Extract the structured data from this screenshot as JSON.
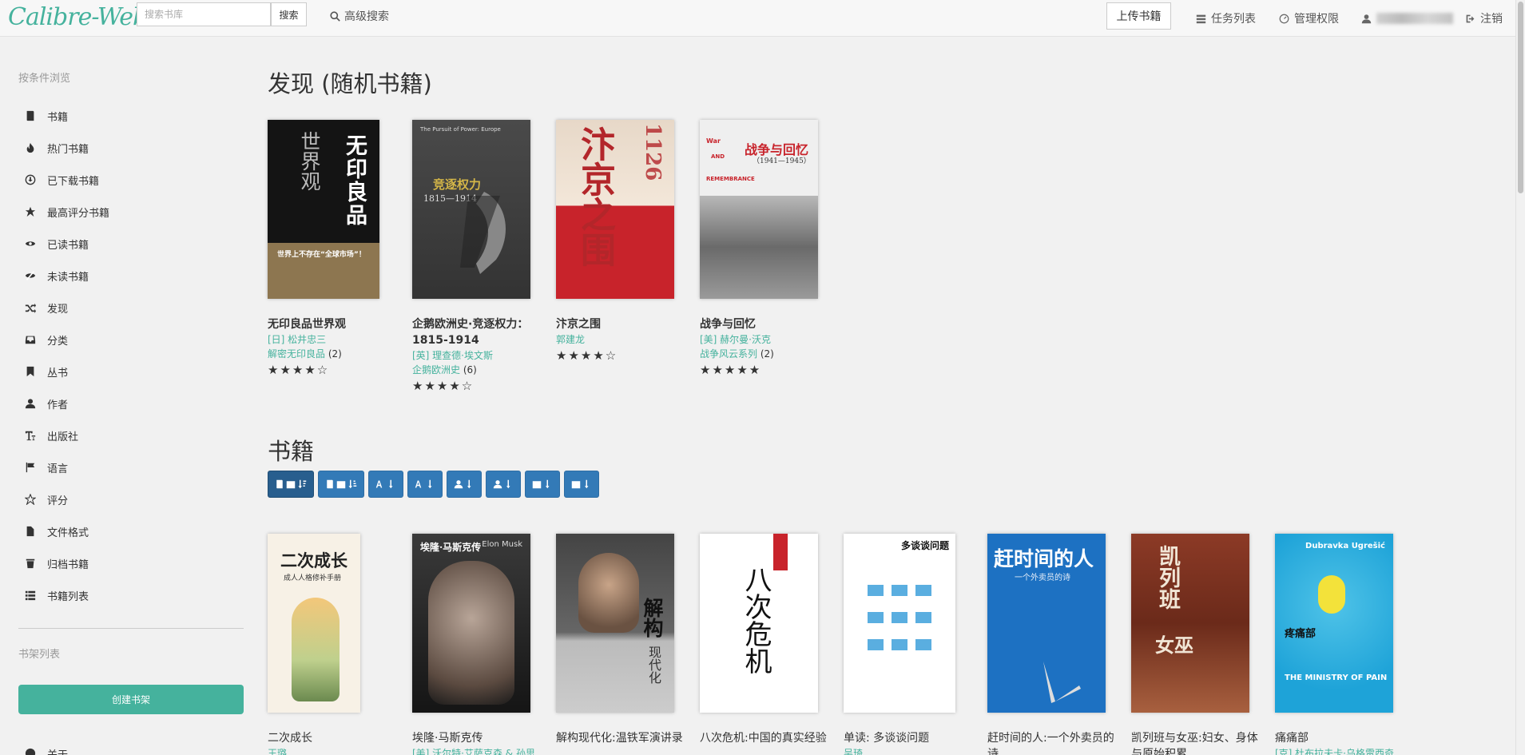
{
  "navbar": {
    "logo": "Calibre-Web",
    "search_placeholder": "搜索书库",
    "search_button": "搜索",
    "advanced_search": "高级搜索",
    "upload": "上传书籍",
    "tasks": "任务列表",
    "admin": "管理权限",
    "logout": "注销"
  },
  "sidebar": {
    "browse_header": "按条件浏览",
    "items": [
      {
        "label": "书籍",
        "icon": "book-icon"
      },
      {
        "label": "热门书籍",
        "icon": "fire-icon"
      },
      {
        "label": "已下载书籍",
        "icon": "download-icon"
      },
      {
        "label": "最高评分书籍",
        "icon": "star-icon"
      },
      {
        "label": "已读书籍",
        "icon": "eye-icon"
      },
      {
        "label": "未读书籍",
        "icon": "eye-slash-icon"
      },
      {
        "label": "发现",
        "icon": "random-icon"
      },
      {
        "label": "分类",
        "icon": "inbox-icon"
      },
      {
        "label": "丛书",
        "icon": "bookmark-icon"
      },
      {
        "label": "作者",
        "icon": "user-icon"
      },
      {
        "label": "出版社",
        "icon": "text-size-icon"
      },
      {
        "label": "语言",
        "icon": "flag-icon"
      },
      {
        "label": "评分",
        "icon": "star-empty-icon"
      },
      {
        "label": "文件格式",
        "icon": "file-icon"
      },
      {
        "label": "归档书籍",
        "icon": "trash-icon"
      },
      {
        "label": "书籍列表",
        "icon": "list-icon"
      }
    ],
    "shelves_header": "书架列表",
    "create_shelf": "创建书架",
    "about": "关于"
  },
  "discover": {
    "title": "发现 (随机书籍)",
    "books": [
      {
        "title": "无印良品世界观",
        "author": "[日] 松井忠三",
        "series": "解密无印良品",
        "count": "(2)",
        "stars": "★★★★☆"
      },
      {
        "title": "企鹅欧洲史·竞逐权力：1815-1914",
        "author": "[英] 理查德·埃文斯",
        "series": "企鹅欧洲史",
        "count": "(6)",
        "stars": "★★★★☆"
      },
      {
        "title": "汴京之围",
        "author": "郭建龙",
        "series": "",
        "count": "",
        "stars": "★★★★☆"
      },
      {
        "title": "战争与回忆",
        "author": "[美] 赫尔曼·沃克",
        "series": "战争风云系列",
        "count": "(2)",
        "stars": "★★★★★"
      }
    ]
  },
  "books_section": {
    "title": "书籍",
    "books": [
      {
        "title": "二次成长",
        "author": "王璐"
      },
      {
        "title": "埃隆·马斯克传",
        "author": "[美] 沃尔特·艾萨克森 & 孙思"
      },
      {
        "title": "解构现代化:温铁军演讲录",
        "author": ""
      },
      {
        "title": "八次危机:中国的真实经验",
        "author": ""
      },
      {
        "title": "单读: 多谈谈问题",
        "author": "吴琦"
      },
      {
        "title": "赶时间的人:一个外卖员的诗",
        "author": ""
      },
      {
        "title": "凯列班与女巫:妇女、身体与原始积累",
        "author": ""
      },
      {
        "title": "痛痛部",
        "author": "[克] 杜布拉夫卡·乌格雷西奇"
      }
    ]
  },
  "covers": {
    "c1_a": "无印良品",
    "c1_b": "世界观",
    "c1_c": "世界上不存在“全球市场”！",
    "c2_a": "The Pursuit of Power: Europe",
    "c2_b": "竞逐权力",
    "c2_c": "1815—1914",
    "c3_a": "汴京之围",
    "c3_b": "1126",
    "c4_a": "战争与回忆",
    "c4_b": "（1941—1945）",
    "c4_c": "War",
    "c4_d": "AND",
    "c4_e": "REMEMBRANCE",
    "d1_a": "二次成长",
    "d1_b": "成人人格修补手册",
    "d2_a": "埃隆·马斯克传",
    "d2_b": "Elon Musk",
    "d3_a": "解构",
    "d3_b": "现代化",
    "d4_a": "八次危机",
    "d5_a": "多谈谈问题",
    "d6_a": "赶时间的人",
    "d6_b": "一个外卖员的诗",
    "d7_a": "凯列班",
    "d7_b": "女巫",
    "d8_a": "Dubravka Ugrešić",
    "d8_b": "疼痛部",
    "d8_c": "THE MINISTRY OF PAIN"
  }
}
